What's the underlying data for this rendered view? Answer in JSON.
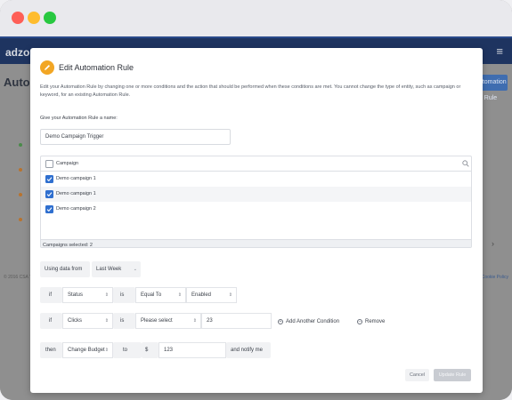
{
  "app": {
    "logo": "adzo",
    "title": "Auto",
    "header_button": "Automation Rule",
    "footer_left": "© 2016 CSA Te",
    "footer_right": "Cookie Policy",
    "menu_icon": "hamburger-icon"
  },
  "modal": {
    "title": "Edit Automation Rule",
    "icon": "pencil-icon",
    "description": "Edit your Automation Rule by changing one or more conditions and the action that should be performed when these conditions are met. You cannot change the type of entity, such as campaign or keyword, for an existing Automation Rule.",
    "name_label": "Give your Automation Rule a name:",
    "name_value": "Demo Campaign Trigger",
    "campaigns": {
      "header": "Campaign",
      "items": [
        {
          "label": "Demo campaign 1",
          "checked": true
        },
        {
          "label": "Demo campaign 1",
          "checked": true
        },
        {
          "label": "Demo campaign 2",
          "checked": true
        }
      ],
      "footer": "Campaigns selected: 2"
    },
    "data_from": {
      "label": "Using data from",
      "value": "Last Week"
    },
    "condition1": {
      "if": "if",
      "metric": "Status",
      "is": "is",
      "operator": "Equal To",
      "value": "Enabled"
    },
    "condition2": {
      "if": "if",
      "metric": "Clicks",
      "is": "is",
      "operator": "Please select",
      "value": "23"
    },
    "add_condition": "Add Another Condition",
    "remove": "Remove",
    "action": {
      "then": "then",
      "action": "Change Budget",
      "to": "to",
      "currency": "$",
      "amount": "123",
      "notify": "and notify me"
    },
    "cancel": "Cancel",
    "update": "Update Rule"
  },
  "colors": {
    "accent": "#2f6fcf",
    "pencil_badge": "#f2a624",
    "nav": "#1e3460"
  }
}
